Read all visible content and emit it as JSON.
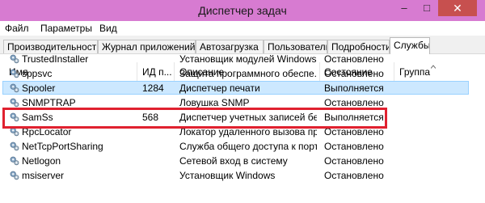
{
  "window": {
    "title": "Диспетчер задач",
    "minimize_glyph": "–",
    "maximize_glyph": "□",
    "close_glyph": "✕"
  },
  "menu": [
    "Файл",
    "Параметры",
    "Вид"
  ],
  "tabs": [
    {
      "label": "Производительность",
      "active": false
    },
    {
      "label": "Журнал приложений",
      "active": false
    },
    {
      "label": "Автозагрузка",
      "active": false
    },
    {
      "label": "Пользователи",
      "active": false
    },
    {
      "label": "Подробности",
      "active": false
    },
    {
      "label": "Службы",
      "active": true
    }
  ],
  "columns": {
    "name": "Имя",
    "pid": "ИД п...",
    "description": "Описание",
    "status": "Состояние",
    "group": "Группа"
  },
  "services": [
    {
      "name": "TrustedInstaller",
      "pid": "",
      "description": "Установщик модулей Windows",
      "status": "Остановлено",
      "group": "",
      "selected": false
    },
    {
      "name": "sppsvc",
      "pid": "",
      "description": "Защита программного обеспе...",
      "status": "Остановлено",
      "group": "",
      "selected": false
    },
    {
      "name": "Spooler",
      "pid": "1284",
      "description": "Диспетчер печати",
      "status": "Выполняется",
      "group": "",
      "selected": true
    },
    {
      "name": "SNMPTRAP",
      "pid": "",
      "description": "Ловушка SNMP",
      "status": "Остановлено",
      "group": "",
      "selected": false
    },
    {
      "name": "SamSs",
      "pid": "568",
      "description": "Диспетчер учетных записей бе...",
      "status": "Выполняется",
      "group": "",
      "selected": false
    },
    {
      "name": "RpcLocator",
      "pid": "",
      "description": "Локатор удаленного вызова пр...",
      "status": "Остановлено",
      "group": "",
      "selected": false
    },
    {
      "name": "NetTcpPortSharing",
      "pid": "",
      "description": "Служба общего доступа к порт...",
      "status": "Остановлено",
      "group": "",
      "selected": false
    },
    {
      "name": "Netlogon",
      "pid": "",
      "description": "Сетевой вход в систему",
      "status": "Остановлено",
      "group": "",
      "selected": false
    },
    {
      "name": "msiserver",
      "pid": "",
      "description": "Установщик Windows",
      "status": "Остановлено",
      "group": "",
      "selected": false
    }
  ],
  "colors": {
    "titlebar": "#d77bd1",
    "selection": "#cce8ff",
    "highlight_box": "#e0212f"
  }
}
